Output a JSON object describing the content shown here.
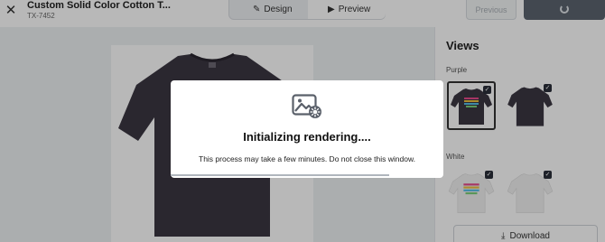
{
  "header": {
    "title": "Custom Solid Color Cotton T...",
    "sku": "TX-7452",
    "modes": {
      "design": "Design",
      "preview": "Preview"
    },
    "previous_label": "Previous"
  },
  "side_panel": {
    "views_title": "Views",
    "groups": [
      {
        "color_name": "Purple",
        "shirt_color": "#3b3642"
      },
      {
        "color_name": "White",
        "shirt_color": "#f2f2f2"
      }
    ],
    "download_label": "Download"
  },
  "modal": {
    "title": "Initializing rendering....",
    "message": "This process may take a few minutes. Do not close this window.",
    "progress": 0.8
  },
  "colors": {
    "shirt": "#3b3642",
    "overlay": "rgba(0,0,0,0.28)",
    "primary_button": "#5c6470"
  }
}
